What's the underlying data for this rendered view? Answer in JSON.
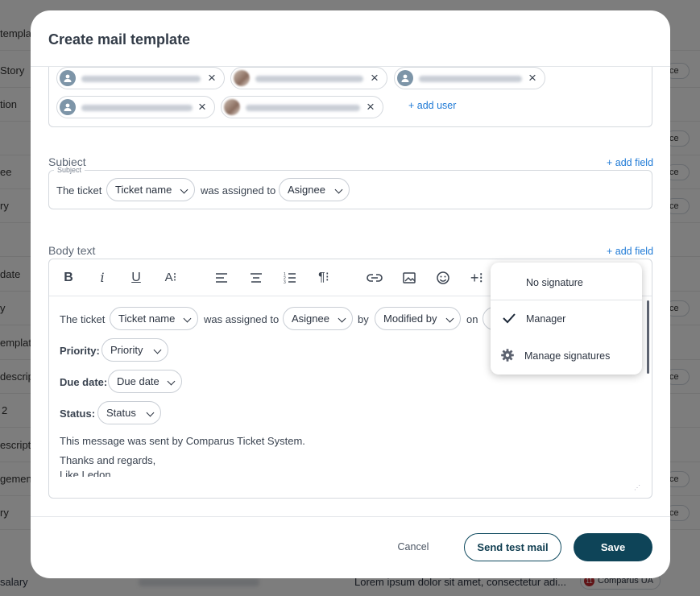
{
  "background": {
    "rows": [
      "template",
      "Story",
      "tion",
      "",
      "ee",
      "ry",
      "",
      "date",
      "y",
      "emplate",
      "descrip",
      "2",
      "escript",
      "gement",
      "ry",
      ""
    ],
    "chip_label": "ce",
    "bottom_row": {
      "label": "salary",
      "description": "Lorem ipsum dolor sit amet, consectetur adi...",
      "company": "Comparus UA",
      "company_badge": "11"
    }
  },
  "modal": {
    "title": "Create mail template",
    "recipients": {
      "add_user": "+ add user",
      "remove_icon": "×"
    },
    "subject": {
      "label": "Subject",
      "add_field": "+ add field",
      "legend": "Subject",
      "text1": "The ticket",
      "pill1": "Ticket name",
      "text2": "was assigned to",
      "pill2": "Asignee"
    },
    "body": {
      "label": "Body text",
      "add_field": "+ add field",
      "toolbar": [
        "bold-icon",
        "italic-icon",
        "underline-icon",
        "font-size-icon",
        "align-left-icon",
        "align-center-icon",
        "numbered-list-icon",
        "paragraph-icon",
        "link-icon",
        "image-icon",
        "emoji-icon",
        "insert-icon"
      ],
      "line1": {
        "t1": "The ticket",
        "p1": "Ticket name",
        "t2": "was assigned to",
        "p2": "Asignee",
        "t3": "by",
        "p3": "Modified by",
        "t4": "on"
      },
      "priority": {
        "label": "Priority:",
        "pill": "Priority"
      },
      "due": {
        "label": "Due date:",
        "pill": "Due date"
      },
      "status": {
        "label": "Status:",
        "pill": "Status"
      },
      "footer1": "This message was sent by Comparus Ticket System.",
      "footer2": "Thanks and regards,",
      "footer3": "Like Ledon"
    },
    "signature_menu": {
      "no_signature": "No signature",
      "manager": "Manager",
      "manage": "Manage signatures"
    },
    "buttons": {
      "cancel": "Cancel",
      "send_test": "Send test mail",
      "save": "Save"
    }
  }
}
